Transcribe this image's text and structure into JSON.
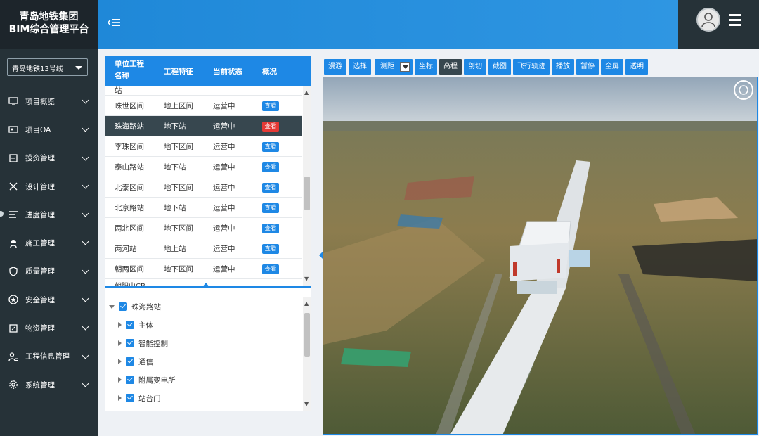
{
  "app": {
    "title_line1": "青岛地铁集团",
    "title_line2": "BIM综合管理平台"
  },
  "line_selector": {
    "value": "青岛地铁13号线"
  },
  "nav": [
    {
      "label": "项目概览",
      "icon": "monitor-icon"
    },
    {
      "label": "项目OA",
      "icon": "id-card-icon"
    },
    {
      "label": "投资管理",
      "icon": "investment-icon"
    },
    {
      "label": "设计管理",
      "icon": "tools-icon"
    },
    {
      "label": "进度管理",
      "icon": "progress-icon"
    },
    {
      "label": "施工管理",
      "icon": "worker-icon"
    },
    {
      "label": "质量管理",
      "icon": "shield-icon"
    },
    {
      "label": "安全管理",
      "icon": "star-badge-icon"
    },
    {
      "label": "物资管理",
      "icon": "materials-icon"
    },
    {
      "label": "工程信息管理",
      "icon": "user-info-icon"
    },
    {
      "label": "系统管理",
      "icon": "gear-icon"
    }
  ],
  "table": {
    "headers": [
      "单位工程名称",
      "工程特征",
      "当前状态",
      "概况"
    ],
    "partial_top": "站",
    "rows": [
      {
        "name": "珠世区间",
        "type": "地上区间",
        "status": "运营中",
        "action": "查看"
      },
      {
        "name": "珠海路站",
        "type": "地下站",
        "status": "运营中",
        "action": "查看",
        "selected": true
      },
      {
        "name": "李珠区间",
        "type": "地下区间",
        "status": "运营中",
        "action": "查看"
      },
      {
        "name": "泰山路站",
        "type": "地下站",
        "status": "运营中",
        "action": "查看"
      },
      {
        "name": "北泰区间",
        "type": "地下区间",
        "status": "运营中",
        "action": "查看"
      },
      {
        "name": "北京路站",
        "type": "地下站",
        "status": "运营中",
        "action": "查看"
      },
      {
        "name": "两北区间",
        "type": "地下区间",
        "status": "运营中",
        "action": "查看"
      },
      {
        "name": "两河站",
        "type": "地上站",
        "status": "运营中",
        "action": "查看"
      },
      {
        "name": "朝两区间",
        "type": "地下区间",
        "status": "运营中",
        "action": "查看"
      }
    ],
    "partial_bottom": "朝阳山CB"
  },
  "tree": {
    "root": "珠海路站",
    "children": [
      "主体",
      "智能控制",
      "通信",
      "附属变电所",
      "站台门"
    ]
  },
  "toolbar": [
    "漫游",
    "选择",
    "测距",
    "坐标",
    "高程",
    "剖切",
    "截图",
    "飞行轨迹",
    "播放",
    "暂停",
    "全屏",
    "透明"
  ],
  "colors": {
    "primary": "#1e88e5",
    "sidebar": "#263238",
    "selected_row": "#37474f",
    "view_button": "#e53935"
  }
}
